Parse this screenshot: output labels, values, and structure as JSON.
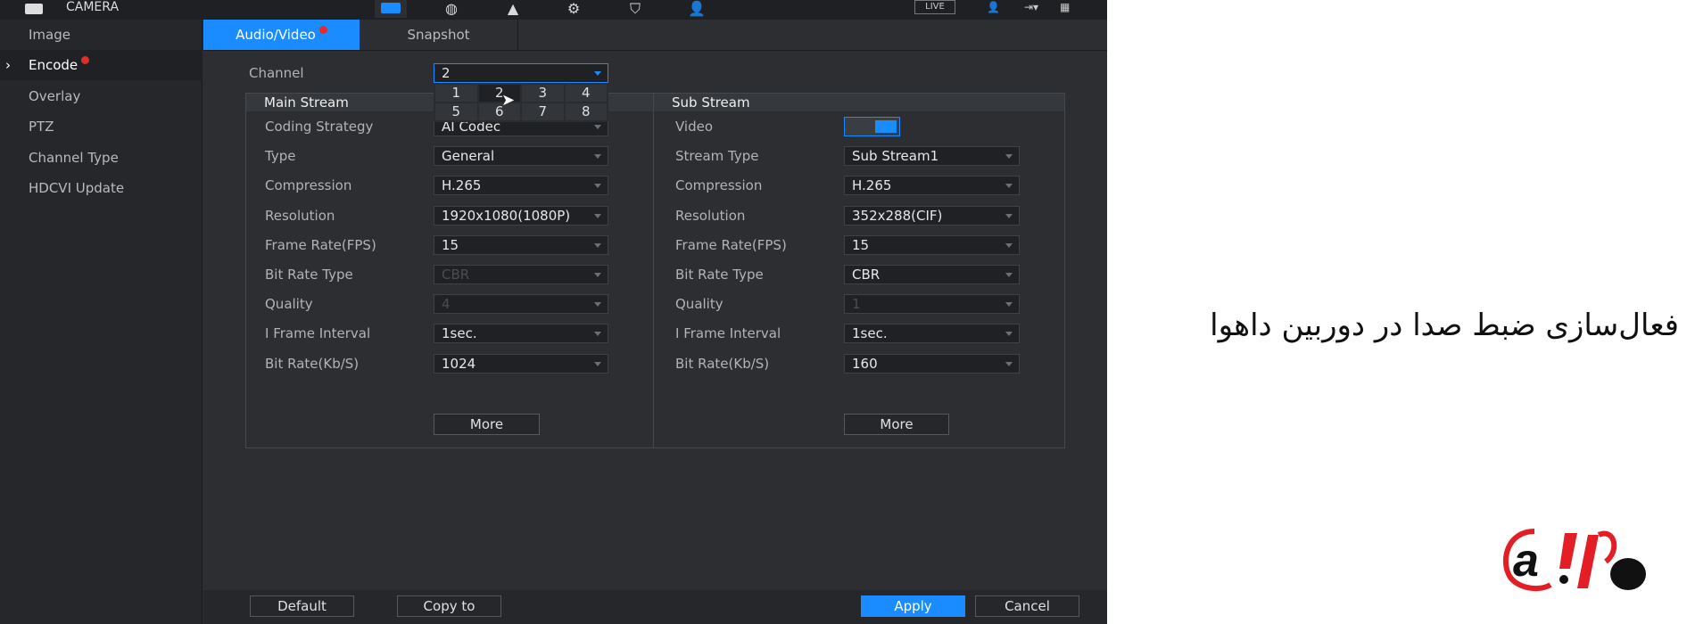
{
  "app": {
    "title": "CAMERA",
    "live": "LIVE"
  },
  "top_icons": [
    "camera-icon",
    "network-globe-icon",
    "storage-icon",
    "system-gears-icon",
    "security-shield-icon",
    "account-gear-icon"
  ],
  "sidebar": {
    "items": [
      {
        "label": "Image"
      },
      {
        "label": "Encode",
        "active": true,
        "badge": true
      },
      {
        "label": "Overlay"
      },
      {
        "label": "PTZ"
      },
      {
        "label": "Channel Type"
      },
      {
        "label": "HDCVI Update"
      }
    ]
  },
  "tabs": [
    {
      "label": "Audio/Video",
      "active": true,
      "badge": true
    },
    {
      "label": "Snapshot"
    }
  ],
  "channel": {
    "label": "Channel",
    "value": "2",
    "options": [
      "1",
      "2",
      "3",
      "4",
      "5",
      "6",
      "7",
      "8"
    ]
  },
  "main_stream": {
    "title": "Main Stream",
    "rows": [
      {
        "label": "Coding Strategy",
        "value": "AI Codec"
      },
      {
        "label": "Type",
        "value": "General"
      },
      {
        "label": "Compression",
        "value": "H.265"
      },
      {
        "label": "Resolution",
        "value": "1920x1080(1080P)"
      },
      {
        "label": "Frame Rate(FPS)",
        "value": "15"
      },
      {
        "label": "Bit Rate Type",
        "value": "CBR",
        "disabled": true
      },
      {
        "label": "Quality",
        "value": "4",
        "disabled": true
      },
      {
        "label": "I Frame Interval",
        "value": "1sec."
      },
      {
        "label": "Bit Rate(Kb/S)",
        "value": "1024"
      }
    ],
    "more": "More"
  },
  "sub_stream": {
    "title": "Sub Stream",
    "video_label": "Video",
    "video_enabled": true,
    "rows": [
      {
        "label": "Stream Type",
        "value": "Sub Stream1"
      },
      {
        "label": "Compression",
        "value": "H.265"
      },
      {
        "label": "Resolution",
        "value": "352x288(CIF)"
      },
      {
        "label": "Frame Rate(FPS)",
        "value": "15"
      },
      {
        "label": "Bit Rate Type",
        "value": "CBR"
      },
      {
        "label": "Quality",
        "value": "1",
        "disabled": true
      },
      {
        "label": "I Frame Interval",
        "value": "1sec."
      },
      {
        "label": "Bit Rate(Kb/S)",
        "value": "160"
      }
    ],
    "more": "More"
  },
  "footer": {
    "default": "Default",
    "copy_to": "Copy to",
    "apply": "Apply",
    "cancel": "Cancel"
  },
  "caption": "فعال‌سازی ضبط صدا در دوربین داهوا",
  "logo": {
    "text": "a.ir",
    "colors": {
      "red": "#e31e24",
      "black": "#111111"
    }
  },
  "colors": {
    "accent": "#1a8cff",
    "badge": "#e52b2b",
    "background": "#2c2e32"
  }
}
